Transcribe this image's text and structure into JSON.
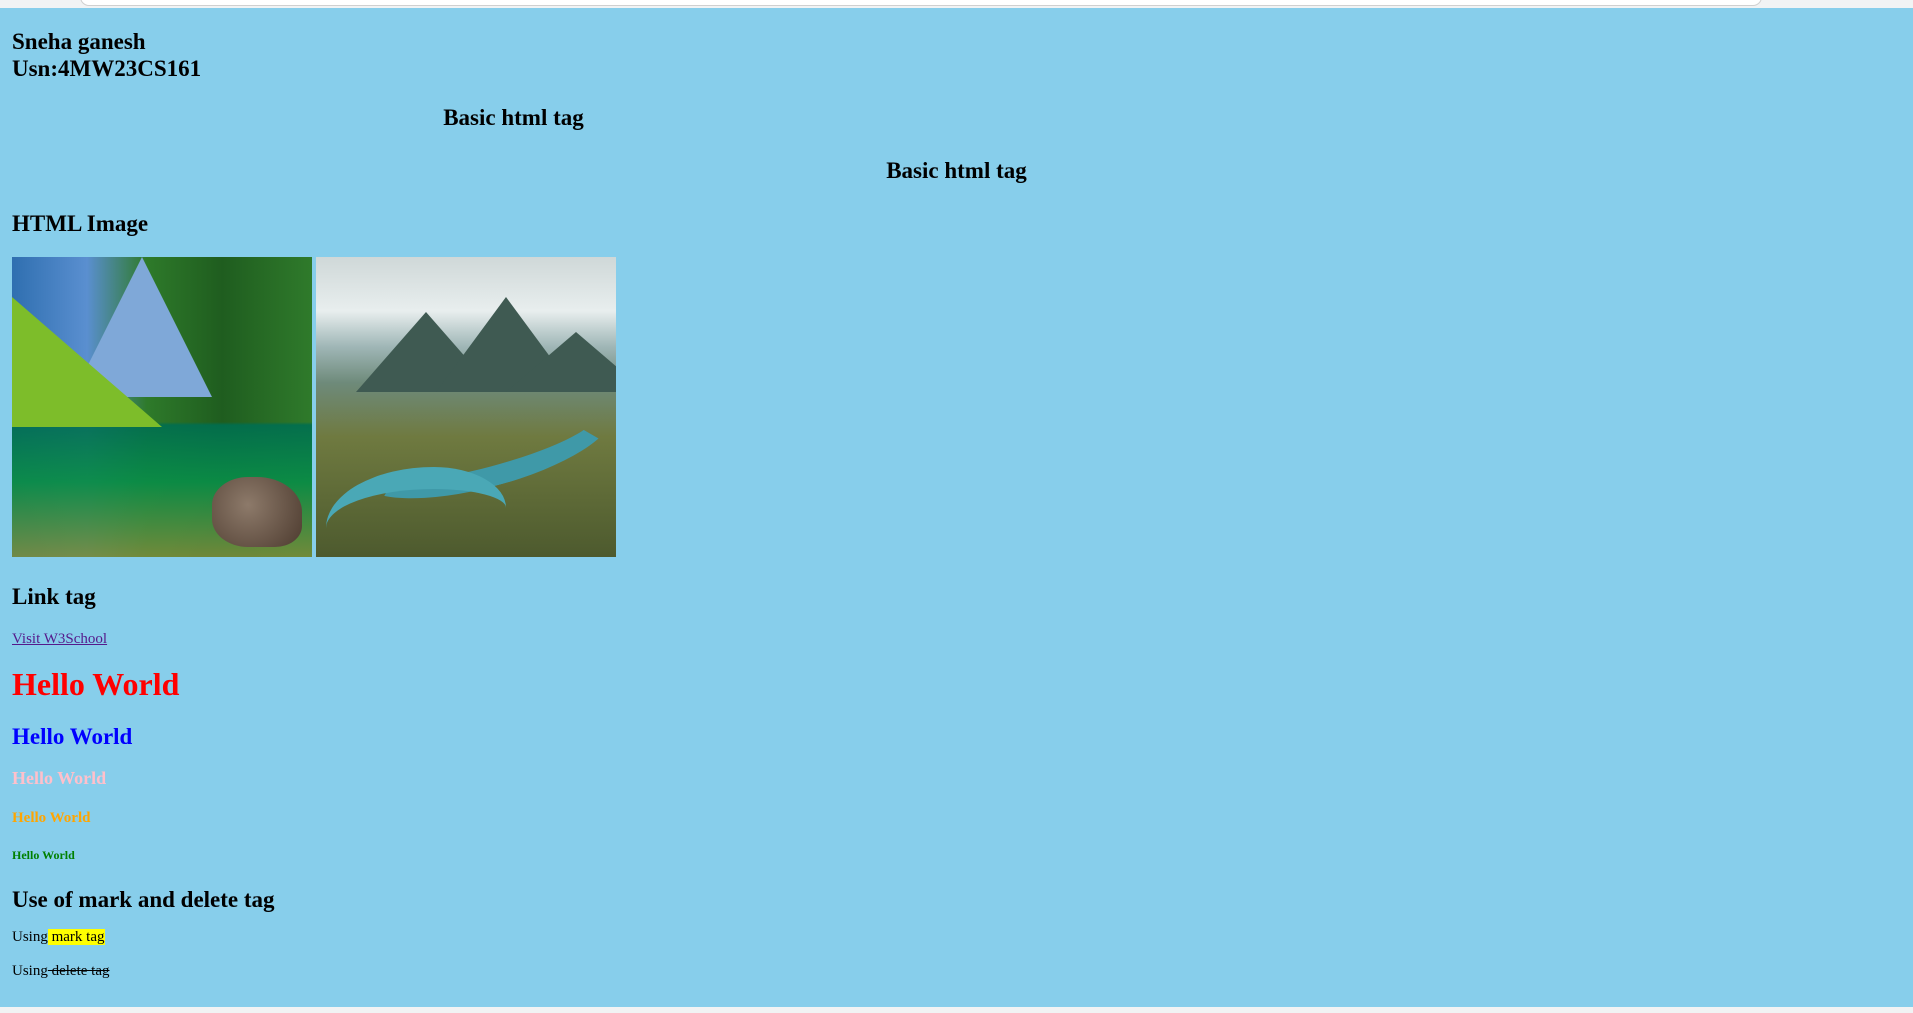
{
  "header": {
    "name": "Sneha ganesh",
    "usn": "Usn:4MW23CS161"
  },
  "headings": {
    "basic_html_tag_1": "Basic html tag",
    "basic_html_tag_2": "Basic html tag",
    "image_section": "HTML Image",
    "link_section": "Link tag",
    "mark_delete_section": "Use of mark and delete tag"
  },
  "images": [
    {
      "alt": "mountain lake with forest"
    },
    {
      "alt": "mountain river valley"
    }
  ],
  "link": {
    "text": "Visit W3School"
  },
  "hello_world": {
    "h1": "Hello World",
    "h2": "Hello World",
    "h3": "Hello World",
    "h4": "Hello World",
    "h5": "Hello World"
  },
  "mark_paragraph": {
    "prefix": "Using",
    "marked": " mark tag"
  },
  "delete_paragraph": {
    "prefix": "Using",
    "deleted": " delete tag"
  },
  "colors": {
    "background": "#87ceeb",
    "hello_red": "#ff0000",
    "hello_blue": "#0000ff",
    "hello_pink": "#ffc0cb",
    "hello_orange": "#ffa500",
    "hello_green": "#008000",
    "mark": "#ffff00"
  }
}
